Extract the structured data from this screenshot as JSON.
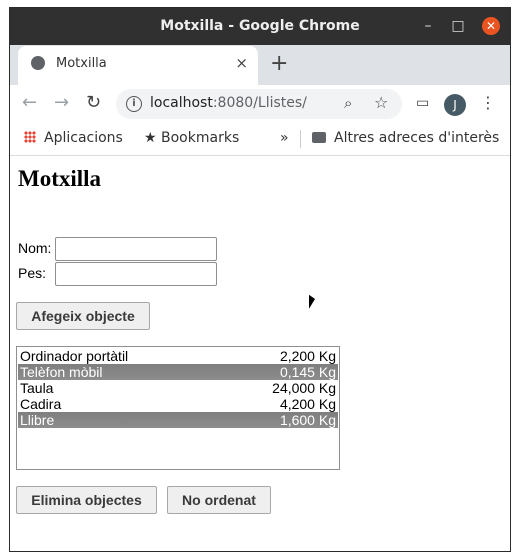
{
  "window": {
    "title": "Motxilla - Google Chrome"
  },
  "tab": {
    "label": "Motxilla",
    "close": "×",
    "new": "+"
  },
  "omnibox": {
    "host": "localhost",
    "path": ":8080/Llistes/"
  },
  "account": {
    "initial": "J"
  },
  "bookmarks": {
    "apps": "Aplicacions",
    "bookmarks": "Bookmarks",
    "more": "»",
    "other": "Altres adreces d'interès"
  },
  "page": {
    "heading": "Motxilla",
    "form": {
      "name_label": "Nom:",
      "name_value": "",
      "weight_label": "Pes:",
      "weight_value": ""
    },
    "add_button": "Afegeix objecte",
    "items": [
      {
        "name": "Ordinador portàtil",
        "weight": "2,200 Kg",
        "selected": false
      },
      {
        "name": "Telèfon mòbil",
        "weight": "0,145 Kg",
        "selected": true
      },
      {
        "name": "Taula",
        "weight": "24,000 Kg",
        "selected": false
      },
      {
        "name": "Cadira",
        "weight": "4,200 Kg",
        "selected": false
      },
      {
        "name": "Llibre",
        "weight": "1,600 Kg",
        "selected": true
      }
    ],
    "remove_button": "Elimina objectes",
    "sort_button": "No ordenat"
  }
}
